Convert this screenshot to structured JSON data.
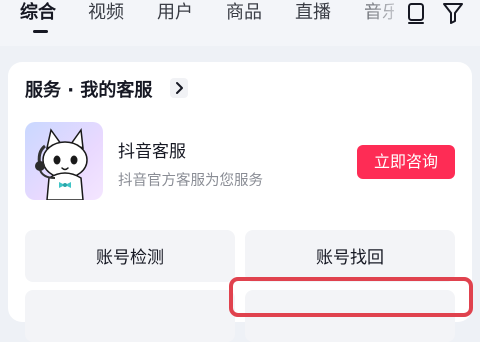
{
  "tabs": [
    {
      "label": "综合",
      "active": true
    },
    {
      "label": "视频",
      "active": false
    },
    {
      "label": "用户",
      "active": false
    },
    {
      "label": "商品",
      "active": false
    },
    {
      "label": "直播",
      "active": false
    },
    {
      "label": "音乐",
      "active": false
    }
  ],
  "toolbar_icons": [
    "panel-icon",
    "filter-icon"
  ],
  "service": {
    "title": "服务 · 我的客服",
    "title_arrow_icon": "chevron-right-icon",
    "agent_name": "抖音客服",
    "agent_desc": "抖音官方客服为您服务",
    "consult_label": "立即咨询",
    "avatar_icon": "cat-mascot-icon"
  },
  "actions": [
    {
      "label": "账号检测"
    },
    {
      "label": "账号找回"
    },
    {
      "label": ""
    },
    {
      "label": ""
    }
  ],
  "colors": {
    "accent": "#fe2c55",
    "highlight": "#e0424e",
    "background": "#eef1f6"
  }
}
